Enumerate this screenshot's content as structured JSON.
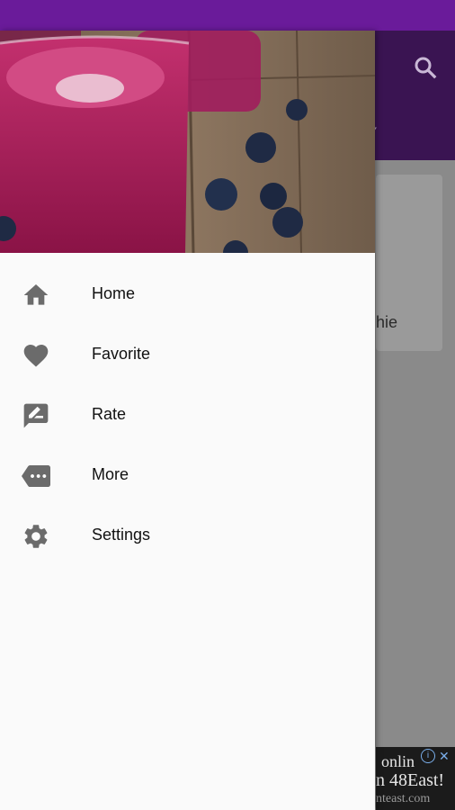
{
  "drawer": {
    "menu": [
      {
        "label": "Home",
        "icon": "home-icon"
      },
      {
        "label": "Favorite",
        "icon": "heart-icon"
      },
      {
        "label": "Rate",
        "icon": "rate-review-icon"
      },
      {
        "label": "More",
        "icon": "more-tag-icon"
      },
      {
        "label": "Settings",
        "icon": "gear-icon"
      }
    ]
  },
  "app": {
    "tab_partial": "Y",
    "card_text_partial": "hie"
  },
  "ad": {
    "line1": "onlin",
    "line2": "n 48East!",
    "line3": "nteast.com",
    "close": "✕",
    "info": "i"
  },
  "colors": {
    "status_bar": "#6a1b9a",
    "icon_gray": "#6b6b6b"
  }
}
